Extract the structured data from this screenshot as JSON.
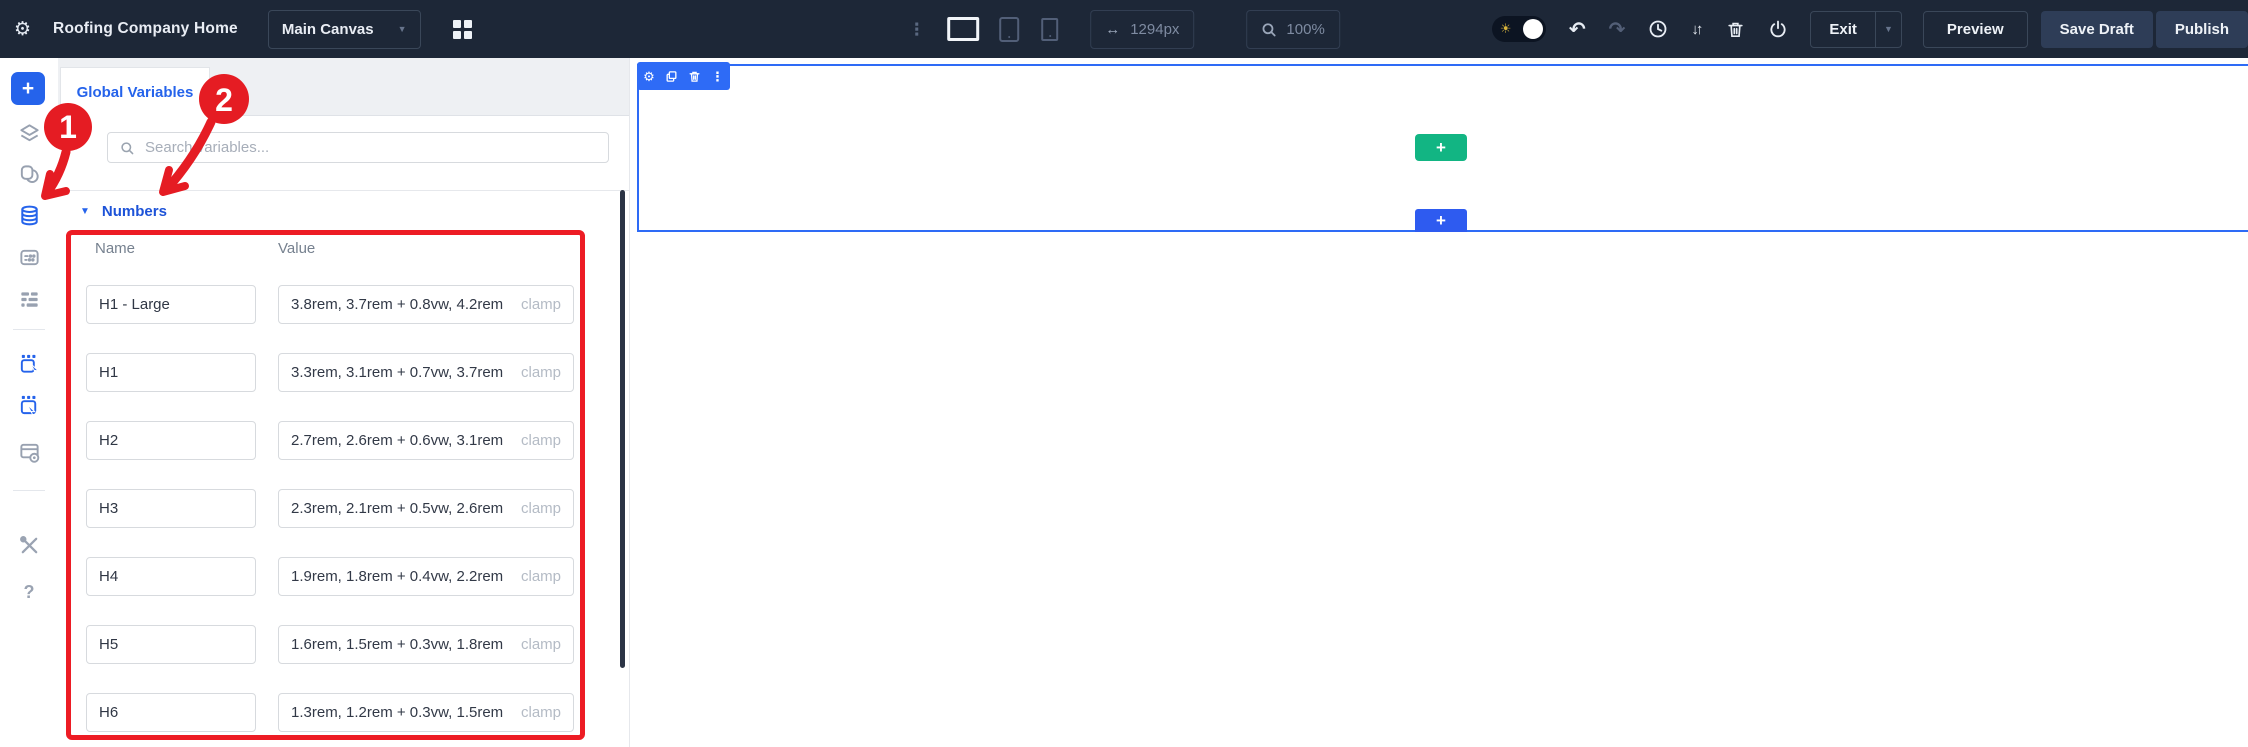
{
  "topbar": {
    "title": "Roofing Company Home",
    "canvas_dropdown": "Main Canvas",
    "width_value": "1294px",
    "zoom_value": "100%",
    "exit": "Exit",
    "preview": "Preview",
    "save_draft": "Save Draft",
    "publish": "Publish"
  },
  "icons": {
    "gear": "⚙",
    "kebab": "⋮",
    "chevron_down": "▼",
    "sun": "☀",
    "undo": "↶",
    "redo": "↷",
    "sort": "↓↑",
    "width": "↔",
    "plus": "+",
    "help": "?",
    "section_triangle": "▼"
  },
  "sidebar": {
    "items": [
      "add-element",
      "layers",
      "template-pages",
      "global-data",
      "button-presets",
      "form-fields",
      "select-element",
      "select-element-alt",
      "browser-settings",
      "tools",
      "help"
    ],
    "active_item": "global-data"
  },
  "panel": {
    "tab": "Global Variables",
    "search_placeholder": "Search variables...",
    "section": "Numbers",
    "name_header": "Name",
    "value_header": "Value",
    "rows": [
      {
        "name": "H1 - Large",
        "value": "3.8rem, 3.7rem + 0.8vw, 4.2rem",
        "suffix": "clamp"
      },
      {
        "name": "H1",
        "value": "3.3rem, 3.1rem + 0.7vw, 3.7rem",
        "suffix": "clamp"
      },
      {
        "name": "H2",
        "value": "2.7rem, 2.6rem + 0.6vw, 3.1rem",
        "suffix": "clamp"
      },
      {
        "name": "H3",
        "value": "2.3rem, 2.1rem + 0.5vw, 2.6rem",
        "suffix": "clamp"
      },
      {
        "name": "H4",
        "value": "1.9rem, 1.8rem + 0.4vw, 2.2rem",
        "suffix": "clamp"
      },
      {
        "name": "H5",
        "value": "1.6rem, 1.5rem + 0.3vw, 1.8rem",
        "suffix": "clamp"
      },
      {
        "name": "H6",
        "value": "1.3rem, 1.2rem + 0.3vw, 1.5rem",
        "suffix": "clamp"
      }
    ]
  },
  "annotations": {
    "step1": "1",
    "step2": "2"
  },
  "canvas": {
    "add_element": "+",
    "add_section": "+"
  },
  "colors": {
    "topbar_bg": "#1d2737",
    "accent_blue": "#2563eb",
    "selection_blue": "#2e6bf6",
    "add_green": "#12b583",
    "annotation_red": "#e51c23"
  }
}
